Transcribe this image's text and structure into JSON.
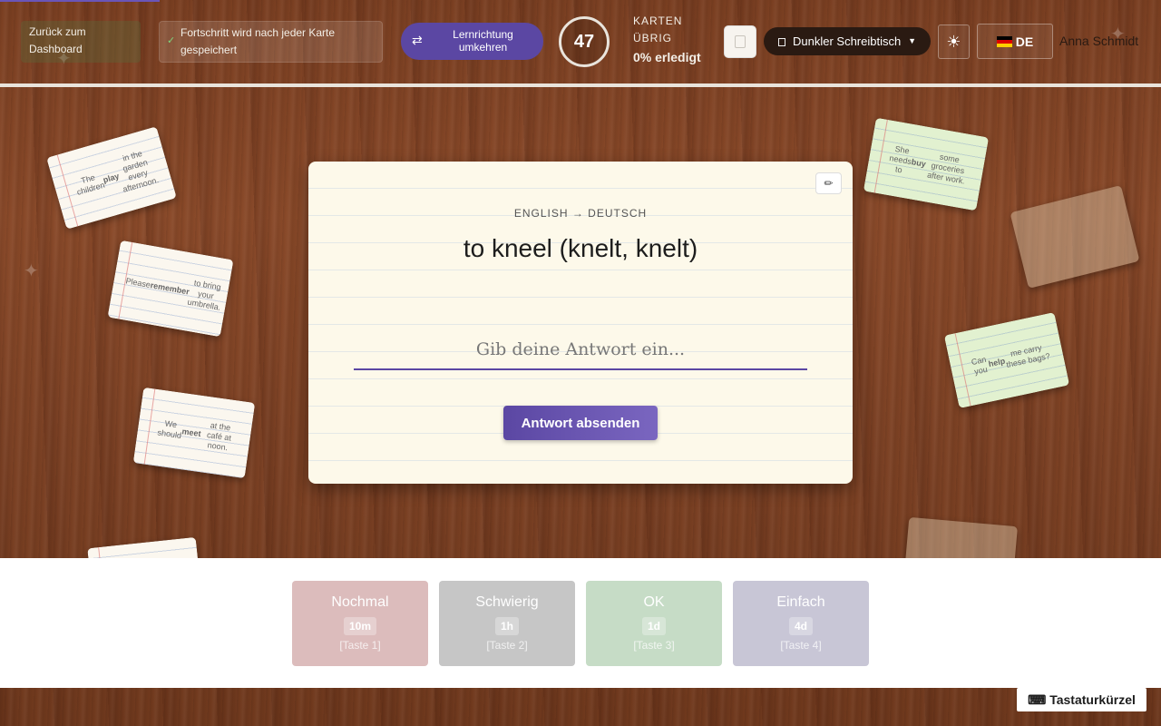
{
  "header": {
    "back_label": "Zurück zum Dashboard",
    "save_note": "Fortschritt wird nach jeder Karte gespeichert",
    "reverse_label": "Lernrichtung umkehren",
    "cards_remaining": "47",
    "cards_remaining_label": "KARTEN ÜBRIG",
    "progress_done": "0% erledigt",
    "theme_select": "Dunkler Schreibtisch",
    "language": "DE",
    "user_name": "Anna Schmidt"
  },
  "background_cards": [
    {
      "html": "The children <b>play</b> in the garden every afternoon."
    },
    {
      "html": "Please <b>remember</b> to bring your umbrella."
    },
    {
      "html": "We should <b>meet</b> at the café at noon."
    },
    {
      "html": "She needs to <b>buy</b> some groceries after work."
    },
    {
      "html": "Can you <b>help</b> me carry these bags?"
    }
  ],
  "card": {
    "direction": "ENGLISH → DEUTSCH",
    "term": "to kneel (knelt, knelt)",
    "answer_value": "",
    "answer_placeholder": "Gib deine Antwort ein...",
    "submit_label": "Antwort absenden"
  },
  "ratings": [
    {
      "label": "Nochmal",
      "interval": "10m",
      "key": "[Taste 1]"
    },
    {
      "label": "Schwierig",
      "interval": "1h",
      "key": "[Taste 2]"
    },
    {
      "label": "OK",
      "interval": "1d",
      "key": "[Taste 3]"
    },
    {
      "label": "Einfach",
      "interval": "4d",
      "key": "[Taste 4]"
    }
  ],
  "shortcuts_label": "⌨ Tastaturkürzel",
  "colors": {
    "accent": "#5b47a3",
    "again": "#dcbcbc",
    "hard": "#c6c6c6",
    "ok": "#c6dcc6",
    "easy": "#c8c6d6"
  },
  "icons": {
    "save": "check-icon",
    "reverse": "swap-icon",
    "theme": "desk-icon",
    "sun": "sun-icon",
    "edit": "pencil-icon",
    "shortcuts": "keyboard-icon"
  }
}
